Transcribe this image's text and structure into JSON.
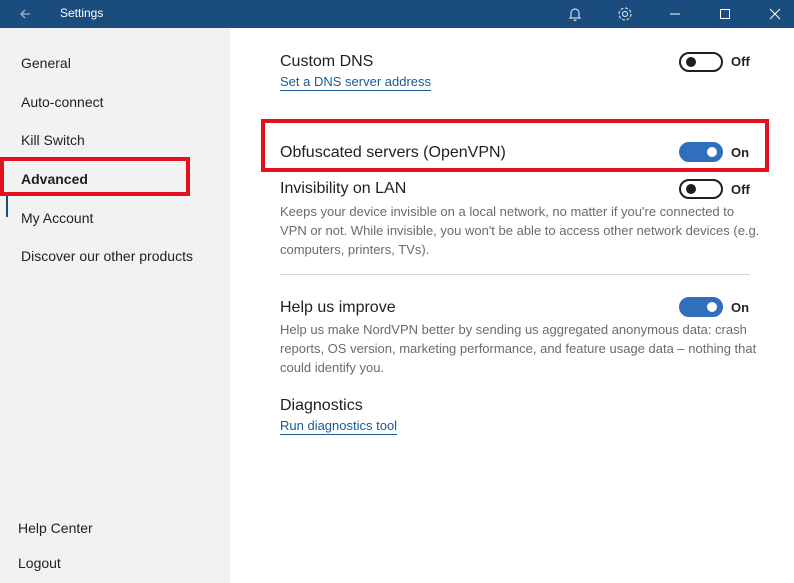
{
  "window": {
    "title": "Settings",
    "icons": [
      "back-arrow-icon",
      "bell-icon",
      "gear-icon",
      "minimize-icon",
      "maximize-icon",
      "close-icon"
    ]
  },
  "sidebar": {
    "items": [
      {
        "label": "General"
      },
      {
        "label": "Auto-connect"
      },
      {
        "label": "Kill Switch"
      },
      {
        "label": "Advanced",
        "active": true
      },
      {
        "label": "My Account"
      },
      {
        "label": "Discover our other products"
      }
    ],
    "footer": [
      {
        "label": "Help Center"
      },
      {
        "label": "Logout"
      }
    ]
  },
  "settings": {
    "custom_dns": {
      "title": "Custom DNS",
      "link": "Set a DNS server address",
      "state": "Off"
    },
    "obfuscated": {
      "title": "Obfuscated servers (OpenVPN)",
      "state": "On"
    },
    "invisibility": {
      "title": "Invisibility on LAN",
      "desc": "Keeps your device invisible on a local network, no matter if you're connected to VPN or not. While invisible, you won't be able to access other network devices (e.g. computers, printers, TVs).",
      "state": "Off"
    },
    "help_improve": {
      "title": "Help us improve",
      "desc": "Help us make NordVPN better by sending us aggregated anonymous data: crash reports, OS version, marketing performance, and feature usage data – nothing that could identify you.",
      "state": "On"
    },
    "diagnostics": {
      "title": "Diagnostics",
      "link": "Run diagnostics tool"
    }
  },
  "colors": {
    "titlebar": "#1a4c7e",
    "toggle_on": "#2f6fbb",
    "highlight": "#e3101f",
    "link": "#1a5a96"
  }
}
